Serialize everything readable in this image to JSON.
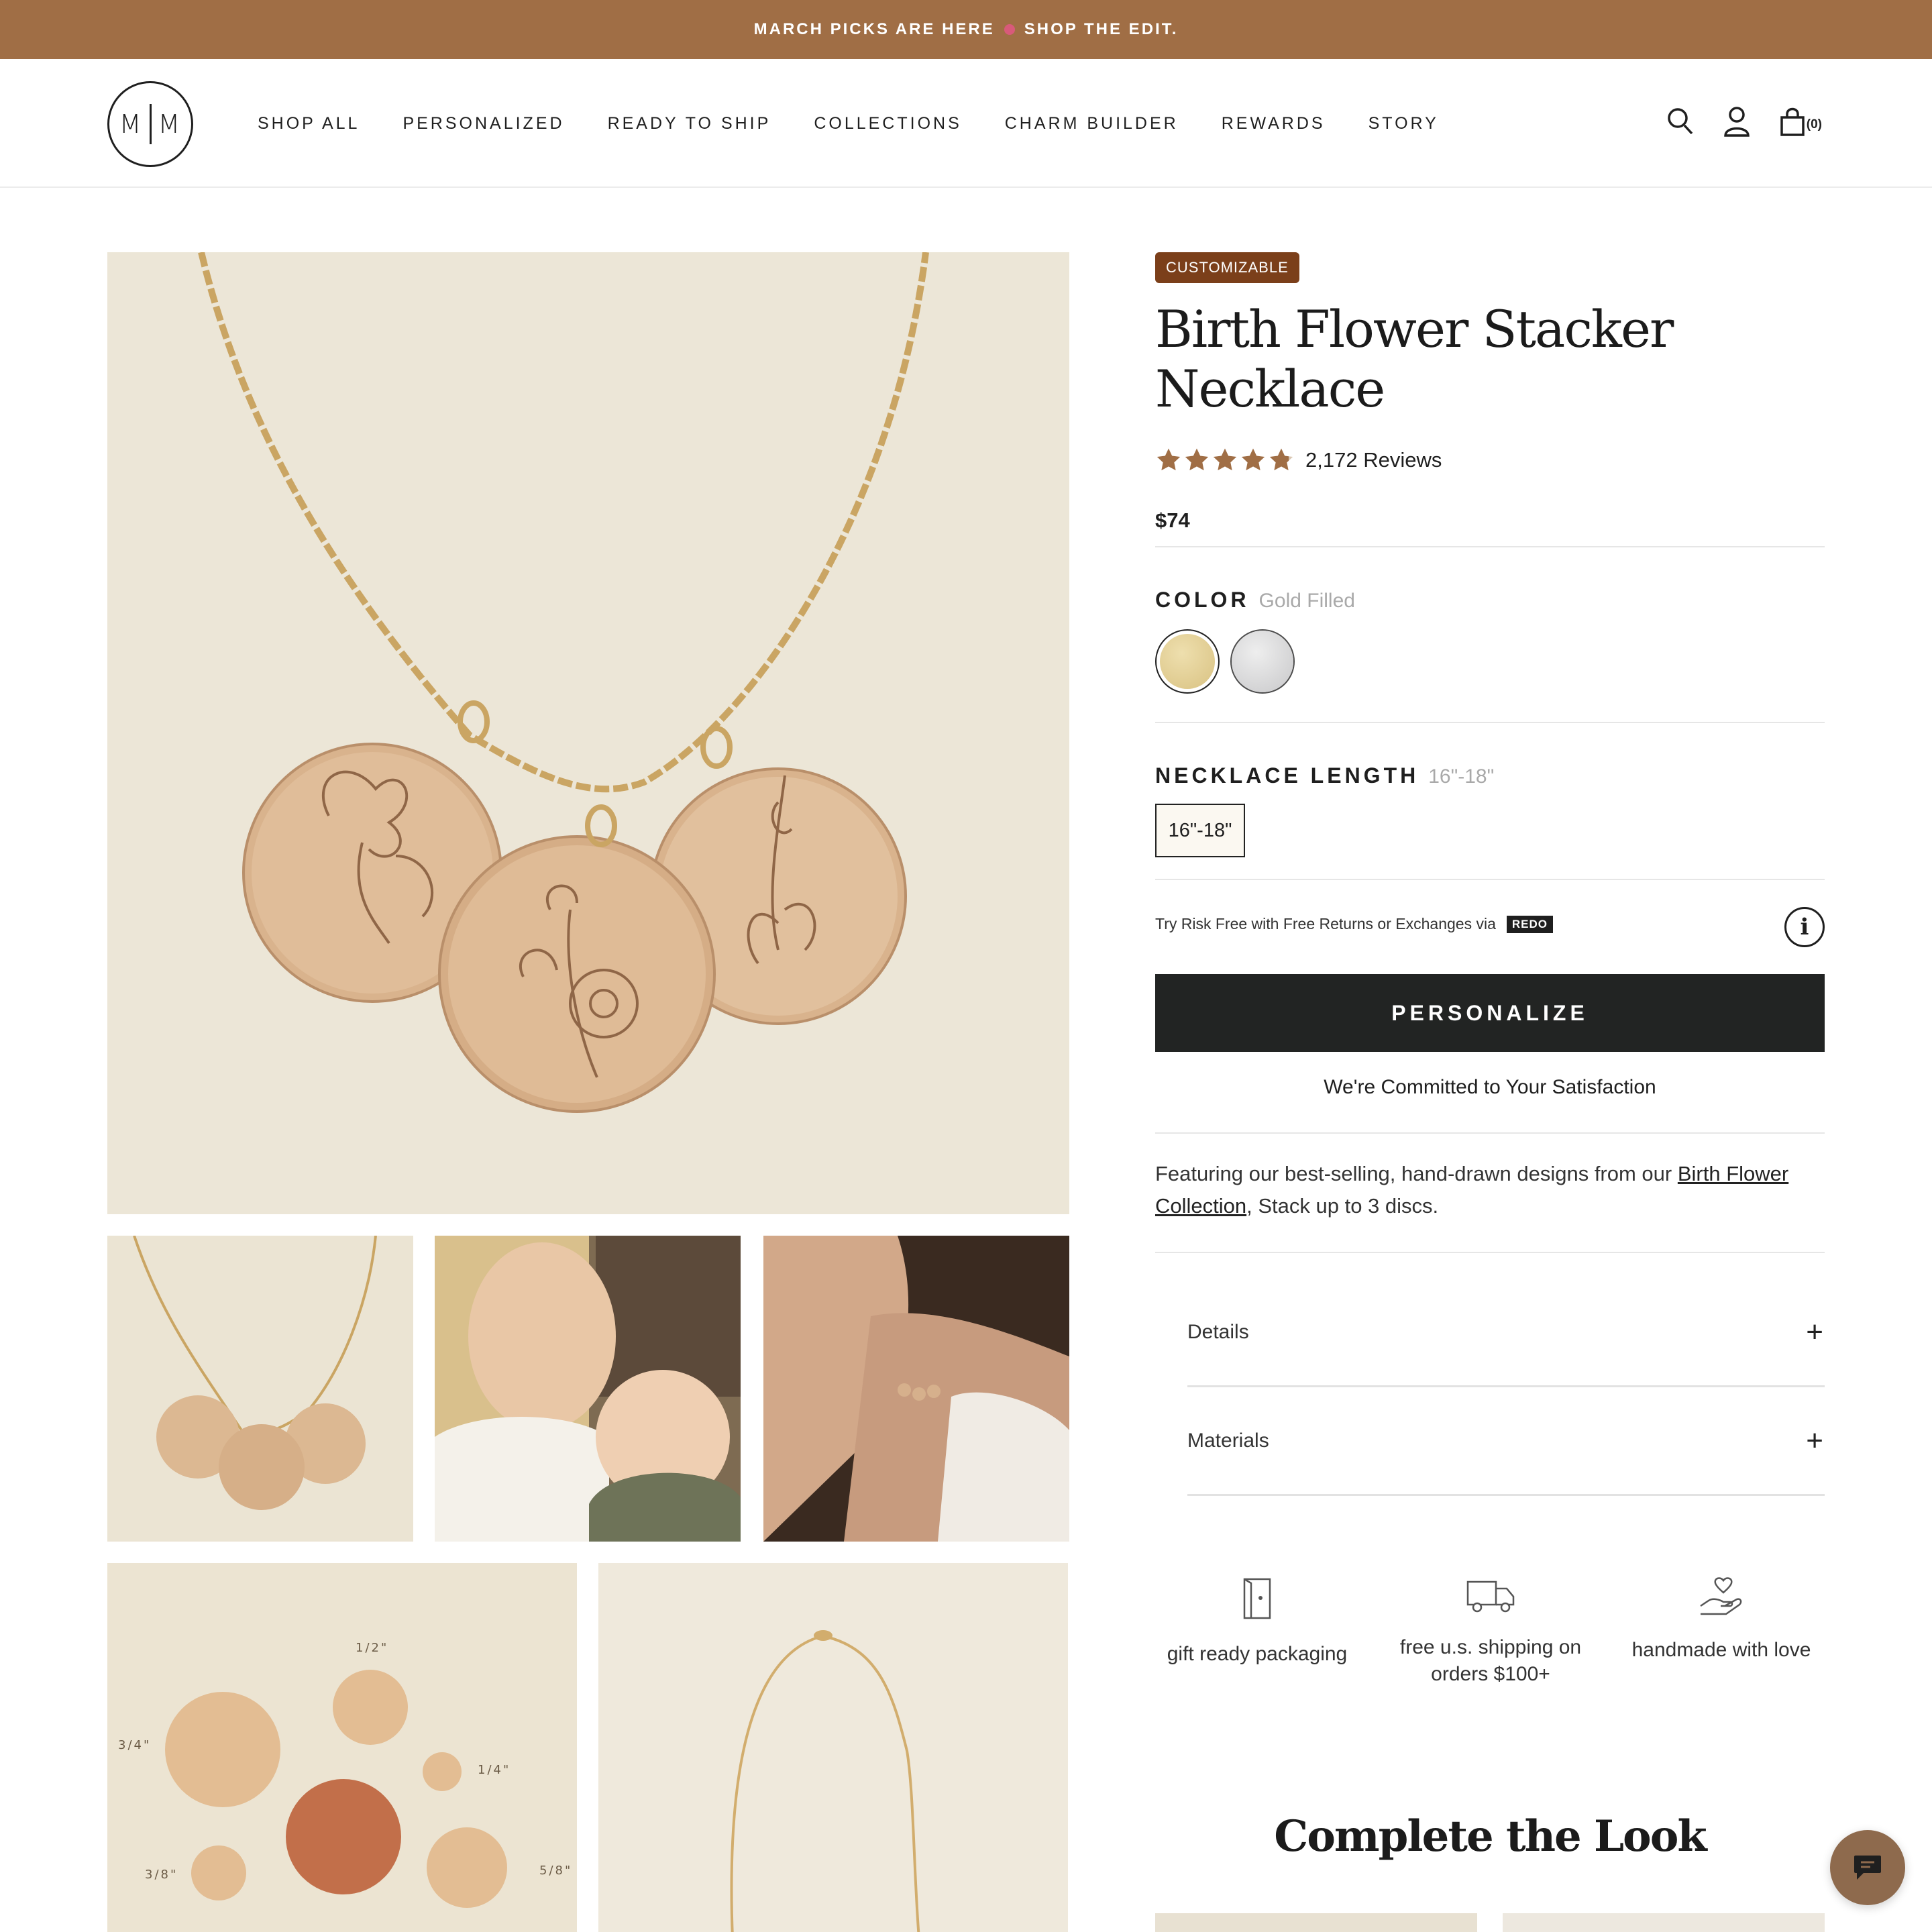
{
  "announcement": {
    "text_before": "MARCH PICKS ARE HERE",
    "text_after": "SHOP THE EDIT."
  },
  "logo": {
    "left": "M",
    "right": "M"
  },
  "nav": [
    "SHOP ALL",
    "PERSONALIZED",
    "READY TO SHIP",
    "COLLECTIONS",
    "CHARM BUILDER",
    "REWARDS",
    "STORY"
  ],
  "header_icons": {
    "search": "search-icon",
    "account": "user-icon",
    "cart": "bag-icon",
    "cart_count": "(0)"
  },
  "product": {
    "badge": "CUSTOMIZABLE",
    "title": "Birth Flower Stacker Necklace",
    "rating": 4.8,
    "reviews": "2,172 Reviews",
    "price": "$74",
    "color_label": "COLOR",
    "color_value": "Gold Filled",
    "colors": [
      {
        "name": "Gold Filled",
        "hex": "#e2cf94",
        "selected": true
      },
      {
        "name": "Sterling Silver",
        "hex": "#d3d3d5",
        "selected": false
      }
    ],
    "length_label": "NECKLACE LENGTH",
    "length_value": "16\"-18\"",
    "length_options": [
      "16\"-18\""
    ],
    "returns_text": "Try Risk Free with Free Returns or Exchanges via",
    "returns_badge": "REDO",
    "cta": "PERSONALIZE",
    "commitment": "We're Committed to Your Satisfaction",
    "desc_before": "Featuring our best-selling, hand-drawn designs from our ",
    "desc_link": "Birth Flower Collection",
    "desc_after": ", Stack up to 3 discs.",
    "accordions": [
      "Details",
      "Materials"
    ]
  },
  "features": [
    {
      "icon": "gift-box-icon",
      "text": "gift ready packaging"
    },
    {
      "icon": "truck-icon",
      "text": "free u.s. shipping on orders $100+"
    },
    {
      "icon": "hand-heart-icon",
      "text": "handmade with love"
    }
  ],
  "complete_the_look": "Complete the Look",
  "size_chart_labels": [
    "1/2\"",
    "3/4\"",
    "1/4\"",
    "3/8\"",
    "5/8\""
  ],
  "colors": {
    "accent": "#a06e45",
    "badge": "#7b3f1a",
    "cta": "#222423",
    "star": "#a06e45"
  }
}
